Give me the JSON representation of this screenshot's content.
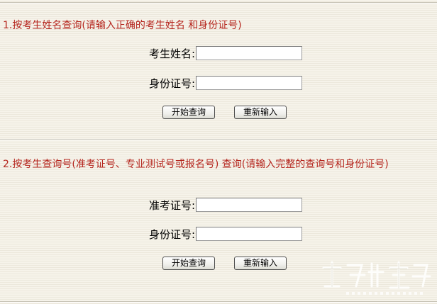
{
  "section1": {
    "title": "1.按考生姓名查询(请输入正确的考生姓名 和身份证号)",
    "name_label": "考生姓名:",
    "name_value": "",
    "id_label": "身份证号:",
    "id_value": "",
    "search_label": "开始查询",
    "reset_label": "重新输入"
  },
  "section2": {
    "title": "2.按考生查询号(准考证号、专业测试号或报名号) 查询(请输入完整的查询号和身份证号)",
    "ticket_label": "准考证号:",
    "ticket_value": "",
    "id_label": "身份证号:",
    "id_value": "",
    "search_label": "开始查询",
    "reset_label": "重新输入"
  },
  "colors": {
    "title_red": "#b5261e",
    "background": "#f3f0e6"
  }
}
